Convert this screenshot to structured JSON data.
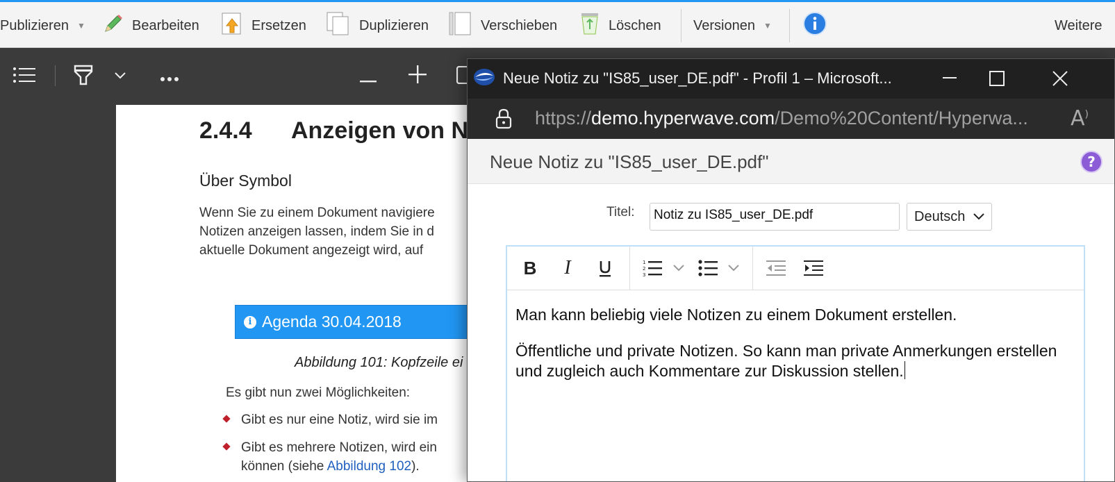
{
  "toolbar": {
    "publish": "Publizieren",
    "edit": "Bearbeiten",
    "replace": "Ersetzen",
    "duplicate": "Duplizieren",
    "move": "Verschieben",
    "delete": "Löschen",
    "versions": "Versionen",
    "more": "Weitere",
    "accent_color": "#2196f3"
  },
  "viewer": {
    "icons": [
      "list-icon",
      "highlighter-icon",
      "chevron-down-icon",
      "more-icon",
      "zoom-out-icon",
      "zoom-in-icon",
      "fit-page-icon"
    ]
  },
  "document": {
    "section_number": "2.4.4",
    "section_title": "Anzeigen von N",
    "subsection": "Über Symbol",
    "para_lines": [
      "Wenn Sie zu einem Dokument navigiere",
      "Notizen anzeigen lassen, indem Sie in d",
      "aktuelle Dokument angezeigt wird, auf"
    ],
    "agenda_banner": "Agenda 30.04.2018",
    "caption": "Abbildung 101: Kopfzeile ei",
    "intro": "Es gibt nun zwei Möglichkeiten:",
    "bullets": [
      "Gibt es nur eine Notiz, wird sie im",
      "Gibt es mehrere Notizen, wird ein"
    ],
    "bullet2_cont_prefix": "können (siehe ",
    "bullet2_link": "Abbildung 102",
    "bullet2_cont_suffix": ")."
  },
  "popup": {
    "window_title": "Neue Notiz zu \"IS85_user_DE.pdf\" - Profil 1 – Microsoft...",
    "url_scheme": "https://",
    "url_host": "demo.hyperwave.com",
    "url_path": "/Demo%20Content/Hyperwa...",
    "header_title": "Neue Notiz zu \"IS85_user_DE.pdf\"",
    "title_label": "Titel:",
    "title_value": "Notiz zu IS85_user_DE.pdf",
    "language": "Deutsch",
    "editor_paragraphs": [
      "Man kann beliebig viele Notizen zu einem Dokument erstellen.",
      "Öffentliche und private Notizen. So kann man private Anmerkungen erstellen und zugleich auch Kommentare zur Diskussion stellen."
    ]
  }
}
